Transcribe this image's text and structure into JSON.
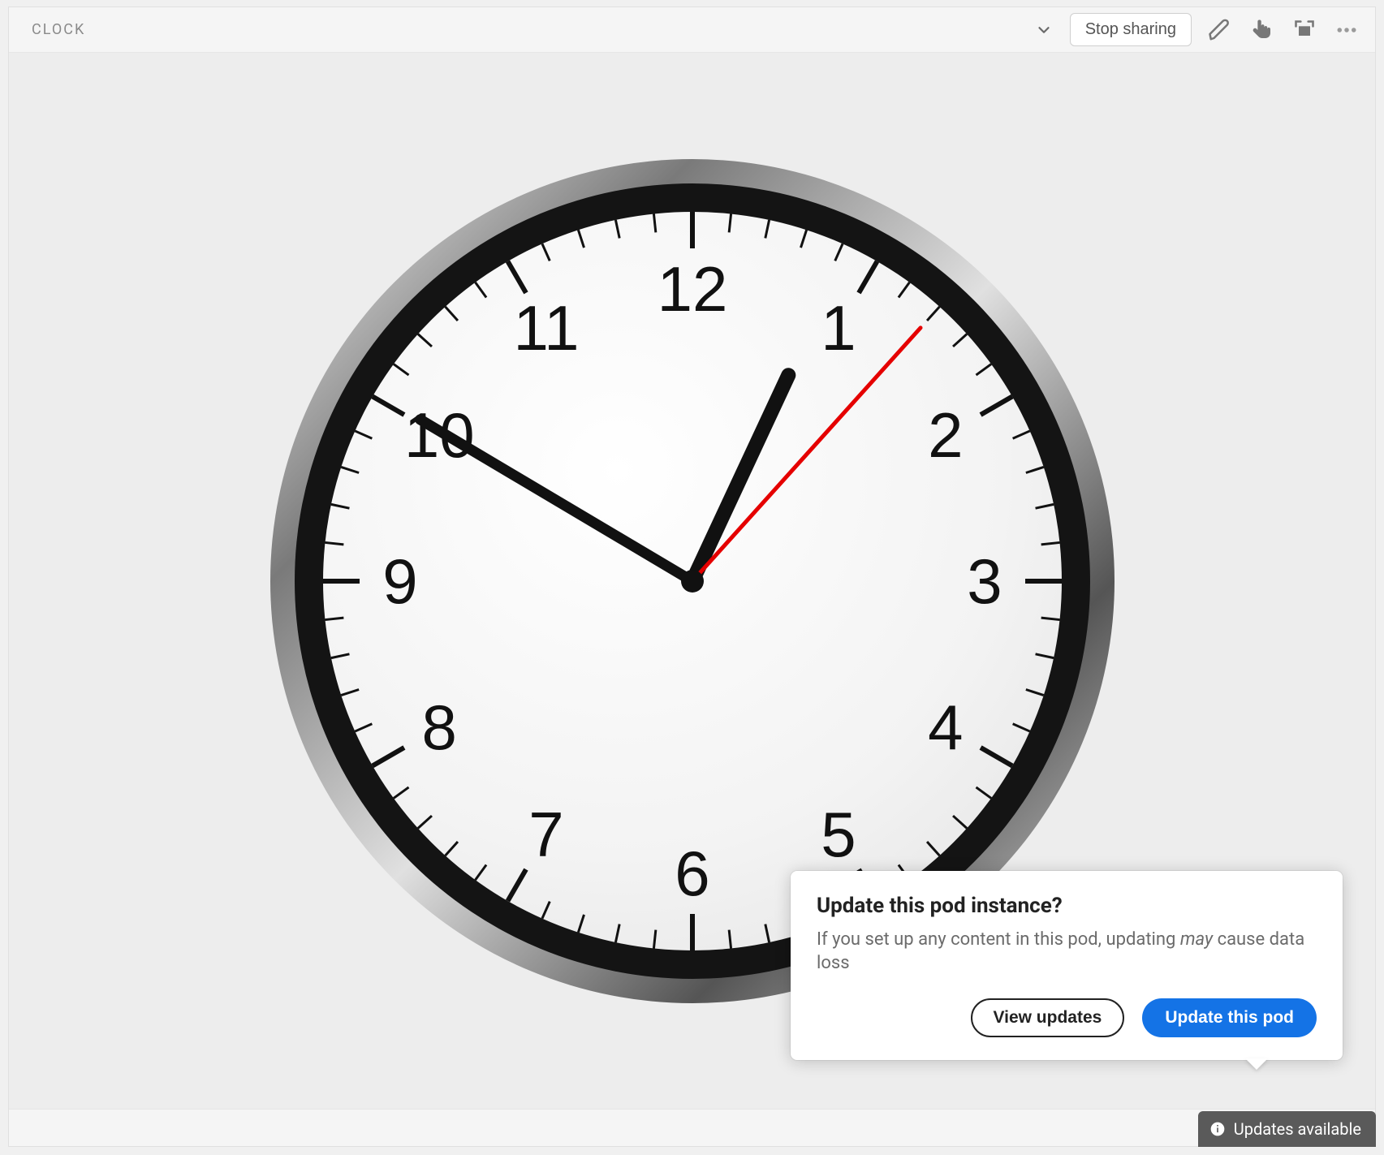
{
  "header": {
    "title": "CLOCK",
    "stop_sharing_label": "Stop sharing"
  },
  "clock": {
    "numerals": [
      "12",
      "1",
      "2",
      "3",
      "4",
      "5",
      "6",
      "7",
      "8",
      "9",
      "10",
      "11"
    ],
    "hour": 12,
    "minute": 50,
    "second": 7,
    "colors": {
      "face": "#f8f8f8",
      "rim": "#2b2b2b",
      "hands": "#111111",
      "second_hand": "#e50000"
    }
  },
  "popover": {
    "title": "Update this pod instance?",
    "body_plain": "If you set up any content in this pod, updating ",
    "body_em": "may",
    "body_tail": " cause data loss",
    "view_updates_label": "View updates",
    "update_label": "Update this pod"
  },
  "status": {
    "updates_available_label": "Updates available"
  }
}
